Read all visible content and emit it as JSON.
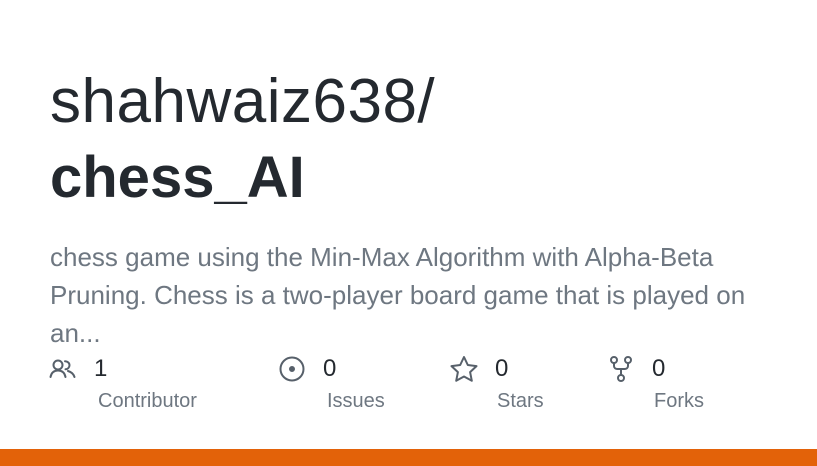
{
  "repo": {
    "owner": "shahwaiz638/",
    "name": "chess_AI",
    "description": "chess game using the Min-Max Algorithm with Alpha-Beta Pruning. Chess is a two-player board game that is played on an..."
  },
  "stats": {
    "contributors": {
      "count": "1",
      "label": "Contributor",
      "icon": "people-icon"
    },
    "issues": {
      "count": "0",
      "label": "Issues",
      "icon": "issue-opened-icon"
    },
    "stars": {
      "count": "0",
      "label": "Stars",
      "icon": "star-icon"
    },
    "forks": {
      "count": "0",
      "label": "Forks",
      "icon": "repo-forked-icon"
    }
  },
  "colors": {
    "text_primary": "#24292f",
    "text_muted": "#6e7781",
    "accent_bar": "#e36209"
  }
}
